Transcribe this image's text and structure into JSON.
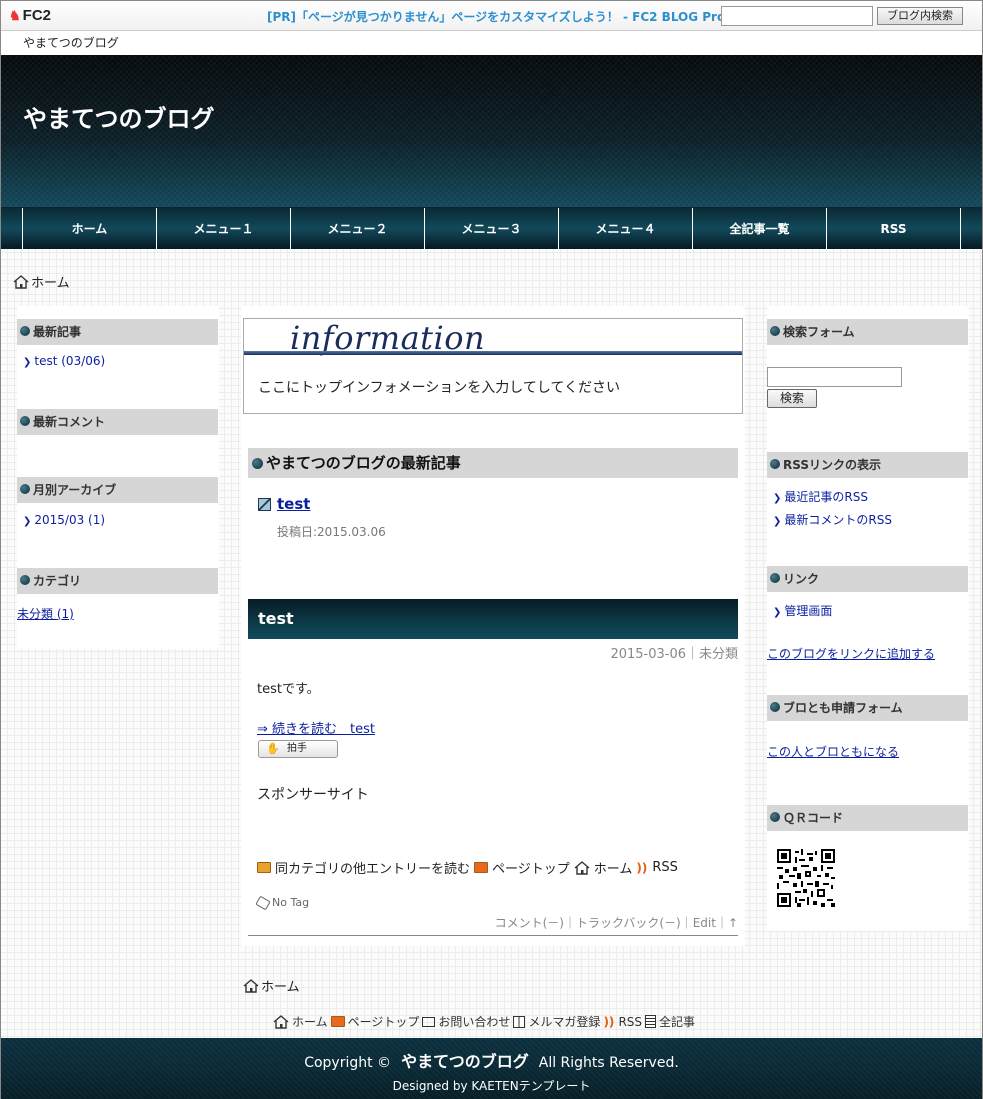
{
  "fc2bar": {
    "logo": "FC2",
    "ad_text": "[PR]「ページが見つかりません」ページをカスタマイズしよう！ - FC2 BLOG Pro",
    "search_placeholder": "",
    "search_button": "ブログ内検索",
    "blog_name": "やまてつのブログ"
  },
  "header": {
    "title": "やまてつのブログ"
  },
  "nav": {
    "items": [
      "ホーム",
      "メニュー１",
      "メニュー２",
      "メニュー３",
      "メニュー４",
      "全記事一覧",
      "RSS"
    ]
  },
  "breadcrumb": {
    "home": "ホーム"
  },
  "left_sidebar": {
    "recent_entries": {
      "heading": "最新記事",
      "items": [
        "test (03/06)"
      ]
    },
    "recent_comments": {
      "heading": "最新コメント"
    },
    "monthly_archive": {
      "heading": "月別アーカイブ",
      "items": [
        "2015/03 (1)"
      ]
    },
    "categories": {
      "heading": "カテゴリ",
      "items": [
        "未分類 (1)"
      ]
    }
  },
  "main": {
    "info": {
      "title": "information",
      "text": "ここにトップインフォメーションを入力してしてください"
    },
    "latest": {
      "heading": "やまてつのブログの最新記事",
      "entry_title": "test",
      "entry_date": "投稿日:2015.03.06"
    },
    "entry": {
      "title": "test",
      "meta": "2015-03-06｜未分類",
      "body": "testです。",
      "more": "⇒ 続きを読む　test",
      "clap": "拍手",
      "sponsor": "スポンサーサイト",
      "links": {
        "same_category": "同カテゴリの他エントリーを読む",
        "page_top": "ページトップ",
        "home": "ホーム",
        "rss": "RSS"
      },
      "tag": "No Tag",
      "footer": "コメント(－)｜トラックバック(－)｜Edit｜↑"
    }
  },
  "right_sidebar": {
    "search": {
      "heading": "検索フォーム",
      "button": "検索"
    },
    "rss": {
      "heading": "RSSリンクの表示",
      "items": [
        "最近記事のRSS",
        "最新コメントのRSS"
      ]
    },
    "links": {
      "heading": "リンク",
      "items": [
        "管理画面"
      ],
      "add_link": "このブログをリンクに追加する"
    },
    "friend": {
      "heading": "ブロとも申請フォーム",
      "link": "この人とブロともになる"
    },
    "qr": {
      "heading": "ＱＲコード"
    }
  },
  "bottom": {
    "breadcrumb_home": "ホーム",
    "footer_links": {
      "home": "ホーム",
      "page_top": "ページトップ",
      "contact": "お問い合わせ",
      "mail": "メルマガ登録",
      "rss": "RSS",
      "all": "全記事"
    },
    "copyright_prefix": "Copyright ©",
    "copyright_name": "やまてつのブログ",
    "copyright_suffix": "All Rights Reserved.",
    "designed_by": "Designed by KAETENテンプレート"
  }
}
